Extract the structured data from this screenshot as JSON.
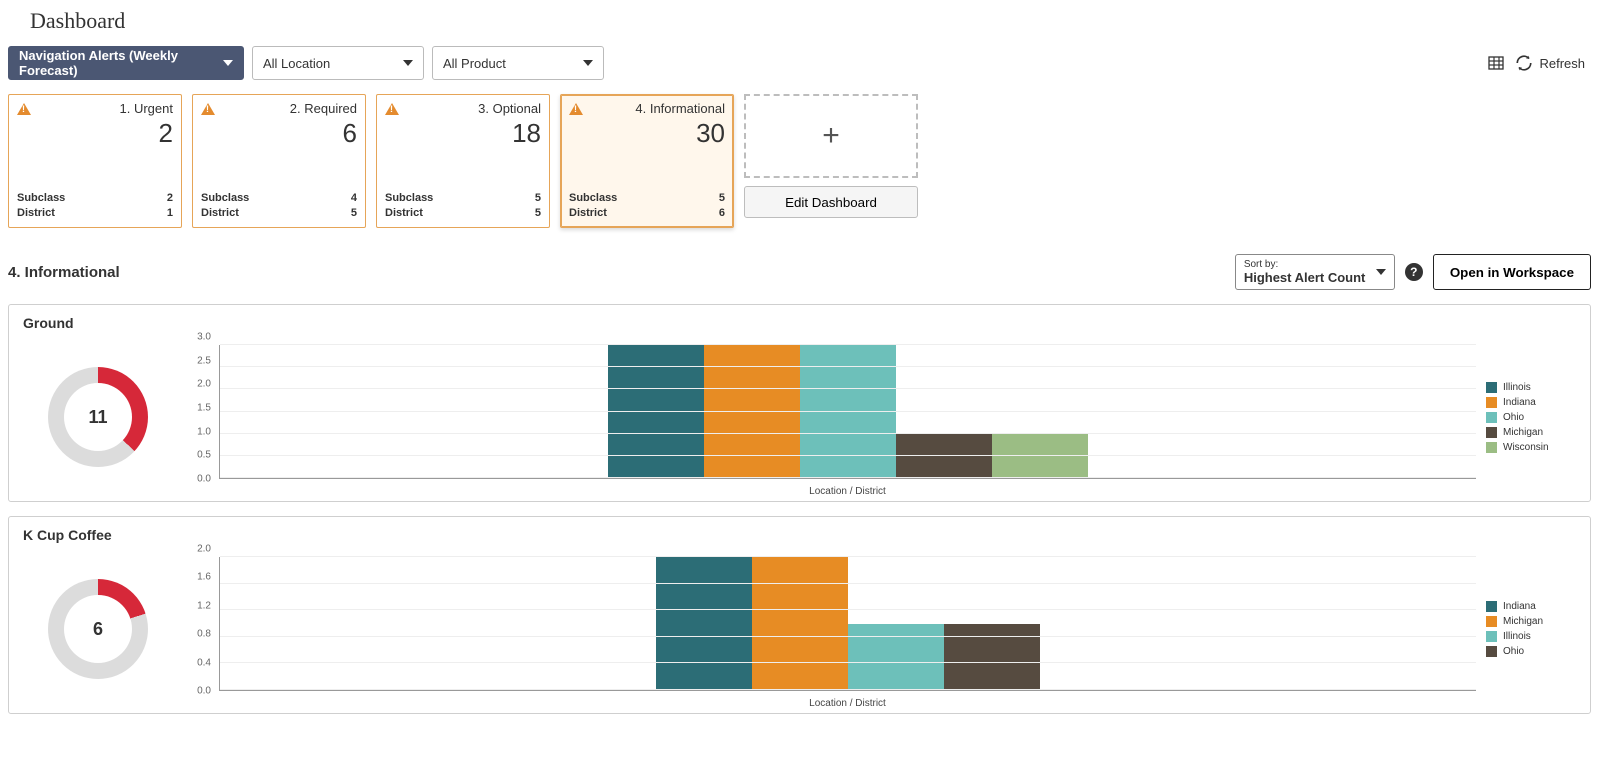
{
  "header": {
    "title": "Dashboard"
  },
  "toolbar": {
    "nav_alerts": "Navigation Alerts (Weekly Forecast)",
    "location": "All Location",
    "product": "All Product",
    "refresh": "Refresh"
  },
  "tiles": [
    {
      "title": "1. Urgent",
      "count": "2",
      "subclass_lbl": "Subclass",
      "subclass_v": "2",
      "district_lbl": "District",
      "district_v": "1"
    },
    {
      "title": "2. Required",
      "count": "6",
      "subclass_lbl": "Subclass",
      "subclass_v": "4",
      "district_lbl": "District",
      "district_v": "5"
    },
    {
      "title": "3. Optional",
      "count": "18",
      "subclass_lbl": "Subclass",
      "subclass_v": "5",
      "district_lbl": "District",
      "district_v": "5"
    },
    {
      "title": "4. Informational",
      "count": "30",
      "subclass_lbl": "Subclass",
      "subclass_v": "5",
      "district_lbl": "District",
      "district_v": "6"
    }
  ],
  "edit_dashboard": "Edit Dashboard",
  "section": {
    "title": "4. Informational",
    "sort_label": "Sort by:",
    "sort_value": "Highest Alert Count",
    "open_workspace": "Open in Workspace"
  },
  "panels": {
    "ground": {
      "title": "Ground",
      "total": "11",
      "pct": 0.37
    },
    "kcup": {
      "title": "K Cup Coffee",
      "total": "6",
      "pct": 0.2
    }
  },
  "chart_data": [
    {
      "type": "bar",
      "title": "Ground",
      "xlabel": "Location / District",
      "ylabel": "",
      "ylim": [
        0,
        3
      ],
      "ticks": [
        0.0,
        0.5,
        1.0,
        1.5,
        2.0,
        2.5,
        3.0
      ],
      "categories": [
        "Illinois",
        "Indiana",
        "Ohio",
        "Michigan",
        "Wisconsin"
      ],
      "values": [
        3,
        3,
        3,
        1,
        1
      ],
      "colors": [
        "#2c6d76",
        "#e78c24",
        "#6dc0ba",
        "#564b40",
        "#9bbd84"
      ]
    },
    {
      "type": "bar",
      "title": "K Cup Coffee",
      "xlabel": "Location / District",
      "ylabel": "",
      "ylim": [
        0,
        2
      ],
      "ticks": [
        0.0,
        0.4,
        0.8,
        1.2,
        1.6,
        2.0
      ],
      "categories": [
        "Indiana",
        "Michigan",
        "Illinois",
        "Ohio"
      ],
      "values": [
        2,
        2,
        1,
        1
      ],
      "colors": [
        "#2c6d76",
        "#e78c24",
        "#6dc0ba",
        "#564b40"
      ]
    }
  ]
}
